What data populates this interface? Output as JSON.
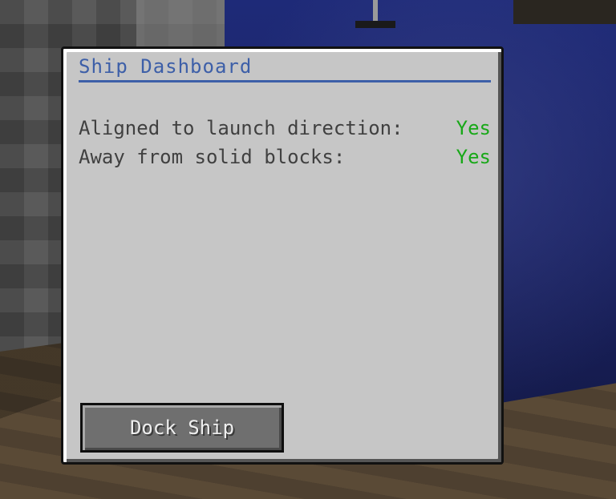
{
  "dialog": {
    "title": "Ship Dashboard",
    "status": [
      {
        "label": "Aligned to launch direction:",
        "value": "Yes"
      },
      {
        "label": "Away from solid blocks:",
        "value": "Yes"
      }
    ],
    "dock_button_label": "Dock Ship"
  },
  "colors": {
    "panel": "#c6c6c6",
    "title": "#3d5fa8",
    "status_ok": "#18a818",
    "button": "#6f6f6f"
  }
}
